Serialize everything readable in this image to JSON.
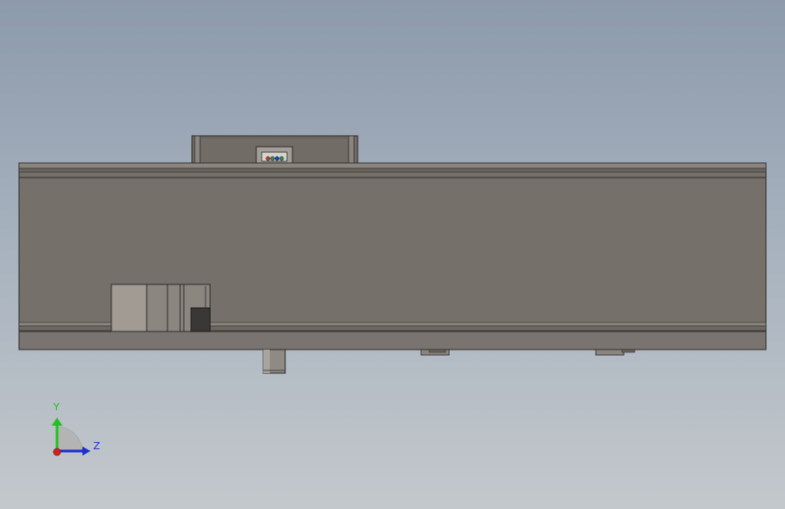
{
  "view": {
    "background_top": "#8d9aab",
    "background_bottom": "#c3c8cc"
  },
  "model": {
    "body_color": "#757069",
    "edge_color": "#2e2c2a",
    "connector_led_colors": [
      "#c0392b",
      "#2e8b57",
      "#1f3fbf",
      "#2e8b57"
    ]
  },
  "triad": {
    "y_label": "Y",
    "z_label": "Z",
    "y_color": "#22c122",
    "z_color": "#1f2fcf",
    "origin_color": "#cc2222"
  }
}
